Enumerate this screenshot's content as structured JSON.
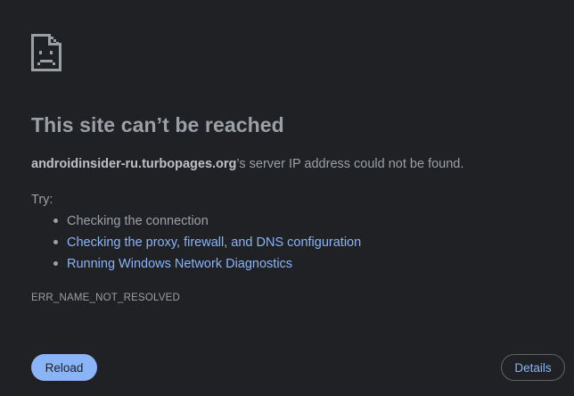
{
  "error_page": {
    "icon": "sad-document-icon",
    "title": "This site can’t be reached",
    "host": "androidinsider-ru.turbopages.org",
    "message_suffix": "’s server IP address could not be found.",
    "try_label": "Try:",
    "suggestions": [
      {
        "label": "Checking the connection",
        "link": false
      },
      {
        "label": "Checking the proxy, firewall, and DNS configuration",
        "link": true
      },
      {
        "label": "Running Windows Network Diagnostics",
        "link": true
      }
    ],
    "error_code": "ERR_NAME_NOT_RESOLVED"
  },
  "buttons": {
    "reload_label": "Reload",
    "details_label": "Details"
  },
  "colors": {
    "background": "#202124",
    "text": "#9aa0a6",
    "link": "#8ab4f8",
    "primary_button": "#8ab4f8"
  }
}
